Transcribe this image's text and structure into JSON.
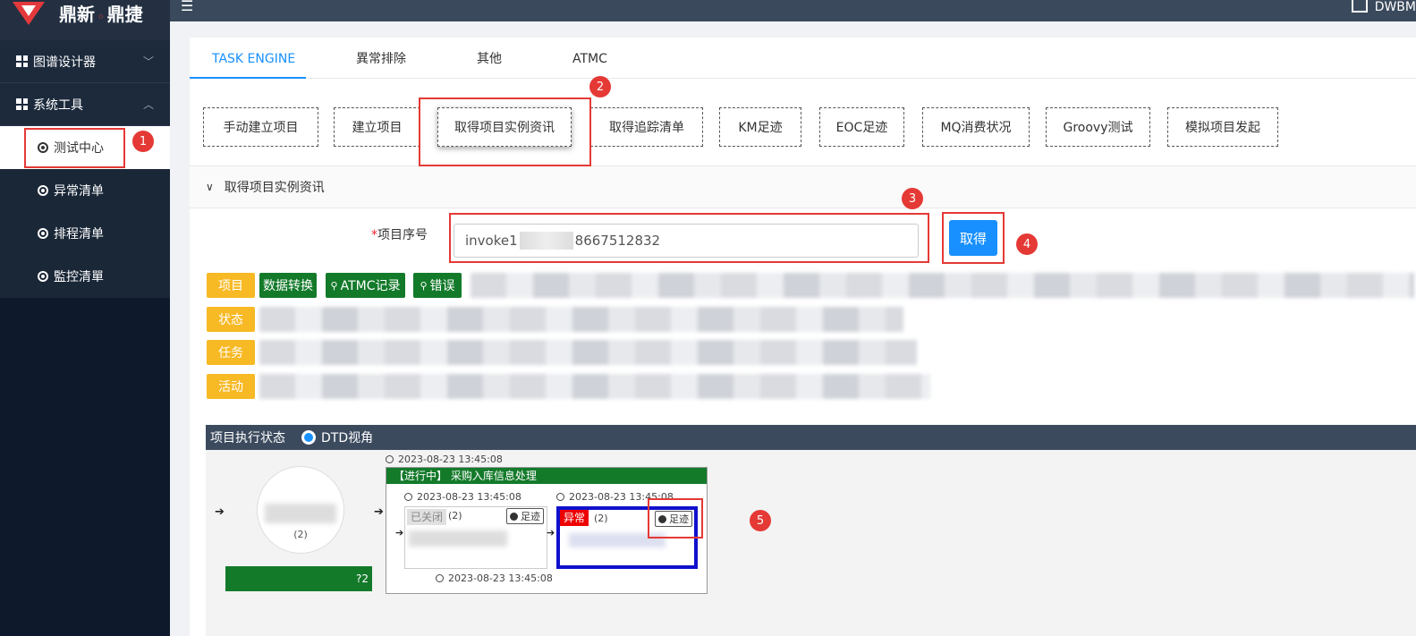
{
  "brand": {
    "text_a": "鼎新",
    "sep": "◦",
    "text_b": "鼎捷"
  },
  "topbar": {
    "user_label": "DWBM"
  },
  "sidebar": {
    "groups": [
      {
        "label": "图谱设计器",
        "chevron": "expand"
      },
      {
        "label": "系统工具",
        "chevron": "collapse"
      }
    ],
    "items": [
      {
        "label": "测试中心",
        "active": true
      },
      {
        "label": "异常清单"
      },
      {
        "label": "排程清单"
      },
      {
        "label": "監控清單"
      }
    ]
  },
  "tabs": [
    "TASK ENGINE",
    "異常排除",
    "其他",
    "ATMC"
  ],
  "toolbar": [
    "手动建立项目",
    "建立项目",
    "取得项目实例资讯",
    "取得追踪清单",
    "KM足迹",
    "EOC足迹",
    "MQ消费状况",
    "Groovy测试",
    "模拟项目发起"
  ],
  "panel": {
    "title": "取得项目实例资讯"
  },
  "form": {
    "label_req": "*",
    "label": "项目序号",
    "value_prefix": "invoke1",
    "value_suffix": "8667512832",
    "submit": "取得"
  },
  "tags": {
    "project": "项目",
    "convert": "数据转换",
    "atmc": "ATMC记录",
    "error": "错误",
    "status": "状态",
    "task": "任务",
    "activity": "活动",
    "search_icon": "🔍"
  },
  "status_section": {
    "title": "项目执行状态",
    "view_option": "DTD视角",
    "circle_count": "(2)",
    "ts_top": "2023-08-23 13:45:08",
    "proc_title": "【进行中】 采购入库信息处理",
    "ts_left": "2023-08-23 13:45:08",
    "ts_right": "2023-08-23 13:45:08",
    "ts_bottom": "2023-08-23 13:45:08",
    "closed_badge": "已关闭",
    "closed_count": "(2)",
    "err_badge": "异常",
    "err_count": "(2)",
    "trace": "足迹",
    "green_suffix": "?2"
  },
  "annotations": [
    "1",
    "2",
    "3",
    "4",
    "5"
  ],
  "colors": {
    "accent": "#1890ff",
    "tag_yellow": "#f7b924",
    "tag_green": "#137a2a",
    "annotation_red": "#e53935"
  }
}
